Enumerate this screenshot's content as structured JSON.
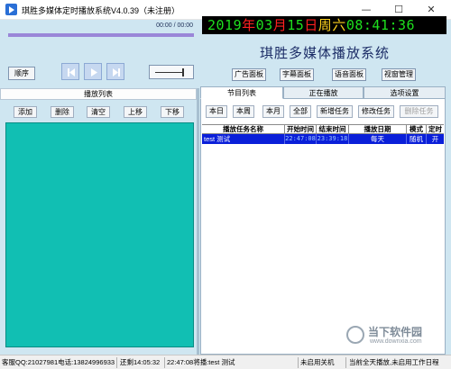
{
  "window": {
    "title": "琪胜多媒体定时播放系统V4.0.39（未注册）",
    "minimize_glyph": "—",
    "maximize_glyph": "☐",
    "close_glyph": "✕"
  },
  "player": {
    "time": "00:00 / 00:00",
    "order_label": "顺序",
    "progress": 0,
    "volume_glyph": "——|"
  },
  "clock": {
    "year": "2019",
    "year_unit": "年",
    "month": "03",
    "month_unit": "月",
    "day": "15",
    "day_unit": "日",
    "weekday": "周六",
    "time": "08:41:36"
  },
  "app_name": "琪胜多媒体播放系统",
  "panel_buttons": [
    "广告面板",
    "字幕面板",
    "语音面板",
    "视窗管理"
  ],
  "left": {
    "tab": "播放列表",
    "buttons": [
      "添加",
      "删除",
      "清空",
      "上移",
      "下移"
    ]
  },
  "right": {
    "tabs": [
      "节目列表",
      "正在播放",
      "选项设置"
    ],
    "buttons": [
      "本日",
      "本周",
      "本月",
      "全部",
      "新增任务",
      "修改任务",
      "删除任务"
    ],
    "columns": [
      "播放任务名称",
      "开始时间",
      "结束时间",
      "播放日期",
      "模式",
      "定时"
    ],
    "rows": [
      {
        "name": "test 测试",
        "start": "22:47:08",
        "end": "23:39:18",
        "date": "每天",
        "mode": "随机",
        "timer": "开"
      }
    ]
  },
  "status": {
    "contact": "客服QQ:21027981电话:13824996933",
    "countdown": "还剩14:05:32",
    "current": "22:47:08将播:test 测试",
    "weekly_off": "未启用关机",
    "day_status": "当前全天播放,未启用工作日程"
  },
  "watermark": {
    "name": "当下软件园",
    "url": "www.downxia.com"
  }
}
